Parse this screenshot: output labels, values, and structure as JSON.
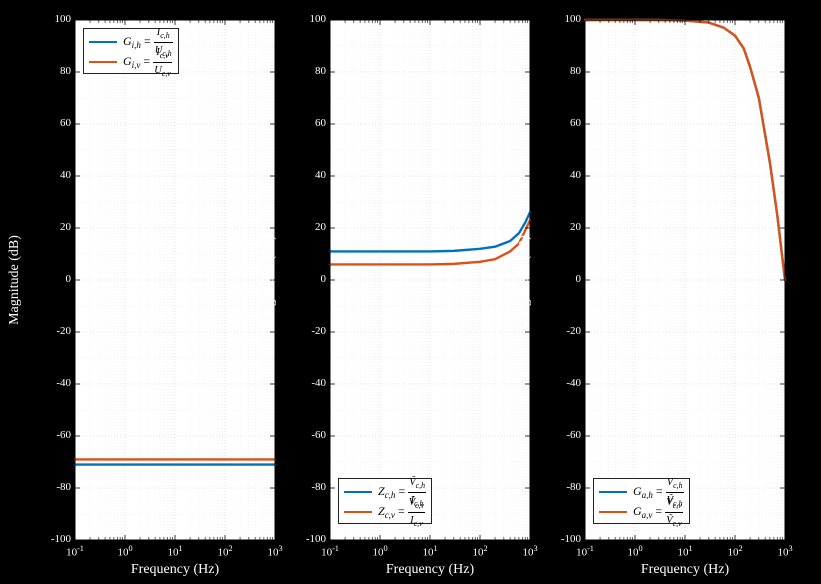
{
  "colors": {
    "series1": "#0072bd",
    "series2": "#d95319",
    "grid": "#cccccc",
    "gridMinor": "#e6e6e6"
  },
  "yticks": {
    "values": [
      -100,
      -80,
      -60,
      -40,
      -20,
      0,
      20,
      40,
      60,
      80,
      100
    ],
    "min": -100,
    "max": 100
  },
  "xticks": {
    "exponents": [
      -1,
      0,
      1,
      2,
      3
    ],
    "labels": [
      "10^{-1}",
      "10^{0}",
      "10^{1}",
      "10^{2}",
      "10^{3}"
    ],
    "logmin": -1,
    "logmax": 3
  },
  "panels": [
    {
      "id": "left",
      "ylabel": "Magnitude (dB)",
      "xlabel": "Frequency (Hz)",
      "legend_pos": "top",
      "legend": [
        {
          "label_html": "<span class='i'>G</span><sub class='s'>i,h</sub> = <span class='frac'><span class='num'><span class='i'>I</span><sub class='s'>c,h</sub></span><span class='den'><span class='i'>U</span><sub class='s'>c,h</sub></span></span>",
          "color": "series1"
        },
        {
          "label_html": "<span class='i'>G</span><sub class='s'>i,v</sub> = <span class='frac'><span class='num'><span class='i'>I</span><sub class='s'>c,v</sub></span><span class='den'><span class='i'>U</span><sub class='s'>c,v</sub></span></span>",
          "color": "series2"
        }
      ]
    },
    {
      "id": "mid",
      "ylabel": "Magnitude (dB)",
      "xlabel": "Frequency (Hz)",
      "legend_pos": "bottom",
      "legend": [
        {
          "label_html": "<span class='i'>Z</span><sub class='s'>c,h</sub> = <span class='frac'><span class='num'><span class='i'>V&#771;</span><sub class='s'>c,h</sub></span><span class='den'><span class='i'>I</span><sub class='s'>c,h</sub></span></span>",
          "color": "series1"
        },
        {
          "label_html": "<span class='i'>Z</span><sub class='s'>c,v</sub> = <span class='frac'><span class='num'><span class='i'>V&#771;</span><sub class='s'>c,v</sub></span><span class='den'><span class='i'>I</span><sub class='s'>c,v</sub></span></span>",
          "color": "series2"
        }
      ]
    },
    {
      "id": "right",
      "ylabel": "Magnitude (dB)",
      "xlabel": "Frequency (Hz)",
      "legend_pos": "bottom",
      "legend": [
        {
          "label_html": "<span class='i'>G</span><sub class='s'>a,h</sub> = <span class='frac'><span class='num'><span class='i'>V</span><sub class='s'>c,h</sub></span><span class='den'><span class='i'>V&#771;</span><sub class='s'>c,h</sub></span></span>",
          "color": "series1"
        },
        {
          "label_html": "<span class='i'>G</span><sub class='s'>a,v</sub> = <span class='frac'><span class='num'><span class='i'>V</span><sub class='s'>c,v</sub></span><span class='den'><span class='i'>V&#771;</span><sub class='s'>c,v</sub></span></span>",
          "color": "series2"
        }
      ]
    }
  ],
  "chart_data": [
    {
      "type": "line",
      "title": "",
      "xlabel": "Frequency (Hz)",
      "ylabel": "Magnitude (dB)",
      "xscale": "log",
      "xlim": [
        0.1,
        1000
      ],
      "ylim": [
        -100,
        100
      ],
      "series": [
        {
          "name": "G_{i,h} = I_{c,h}/U_{c,h}",
          "color": "#0072bd",
          "x": [
            0.1,
            0.3,
            1,
            3,
            10,
            30,
            100,
            300,
            1000
          ],
          "y": [
            -71,
            -71,
            -71,
            -71,
            -71,
            -71,
            -71,
            -71,
            -71
          ]
        },
        {
          "name": "G_{i,v} = I_{c,v}/U_{c,v}",
          "color": "#d95319",
          "x": [
            0.1,
            0.3,
            1,
            3,
            10,
            30,
            100,
            300,
            1000
          ],
          "y": [
            -69,
            -69,
            -69,
            -69,
            -69,
            -69,
            -69,
            -69,
            -69
          ]
        }
      ],
      "legend_position": "upper-left"
    },
    {
      "type": "line",
      "title": "",
      "xlabel": "Frequency (Hz)",
      "ylabel": "Magnitude (dB)",
      "xscale": "log",
      "xlim": [
        0.1,
        1000
      ],
      "ylim": [
        -100,
        100
      ],
      "series": [
        {
          "name": "Z_{c,h} = \\tilde V_{c,h}/I_{c,h}",
          "color": "#0072bd",
          "x": [
            0.1,
            0.3,
            1,
            3,
            10,
            30,
            100,
            200,
            400,
            600,
            800,
            1000
          ],
          "y": [
            11,
            11,
            11,
            11,
            11,
            11.2,
            12,
            12.8,
            15,
            18,
            22,
            26
          ]
        },
        {
          "name": "Z_{c,v} = \\tilde V_{c,v}/I_{c,v}",
          "color": "#d95319",
          "x": [
            0.1,
            0.3,
            1,
            3,
            10,
            30,
            100,
            200,
            400,
            600,
            800,
            1000
          ],
          "y": [
            6,
            6,
            6,
            6,
            6,
            6.2,
            7,
            8,
            11,
            14,
            19,
            23
          ]
        }
      ],
      "legend_position": "lower-left"
    },
    {
      "type": "line",
      "title": "",
      "xlabel": "Frequency (Hz)",
      "ylabel": "Magnitude (dB)",
      "xscale": "log",
      "xlim": [
        0.1,
        1000
      ],
      "ylim": [
        -100,
        100
      ],
      "series": [
        {
          "name": "G_{a,h} = V_{c,h}/\\tilde V_{c,h}",
          "color": "#0072bd",
          "x": [
            0.1,
            0.3,
            1,
            3,
            10,
            30,
            60,
            100,
            150,
            200,
            300,
            500,
            700,
            1000
          ],
          "y": [
            100,
            100,
            100,
            100,
            99.8,
            99,
            97,
            94,
            89,
            82,
            70,
            45,
            25,
            0
          ]
        },
        {
          "name": "G_{a,v} = V_{c,v}/\\tilde V_{c,v}",
          "color": "#d95319",
          "x": [
            0.1,
            0.3,
            1,
            3,
            10,
            30,
            60,
            100,
            150,
            200,
            300,
            500,
            700,
            1000
          ],
          "y": [
            100,
            100,
            100,
            100,
            99.8,
            99,
            97,
            94,
            89,
            82,
            70,
            45,
            25,
            0
          ]
        }
      ],
      "legend_position": "lower-left"
    }
  ]
}
